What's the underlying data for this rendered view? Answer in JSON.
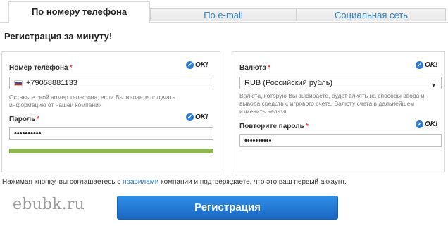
{
  "tabs": [
    {
      "label": "По номеру телефона",
      "active": true
    },
    {
      "label": "По e-mail",
      "active": false
    },
    {
      "label": "Социальная сеть",
      "active": false
    }
  ],
  "section_title": "Регистрация за минуту!",
  "left": {
    "phone": {
      "label": "Номер телефона",
      "required": "*",
      "ok": "OK!",
      "value": "+79058881133",
      "hint": "Оставьте свой номер телефона, если Вы желаете получать информацию от нашей компании"
    },
    "password": {
      "label": "Пароль",
      "required": "*",
      "ok": "OK!",
      "value": "••••••••••",
      "strength": 1.0
    }
  },
  "right": {
    "currency": {
      "label": "Валюта",
      "required": "*",
      "ok": "OK!",
      "value": "RUB (Российский рубль)",
      "hint": "Валюта, которую Вы выбираете, будет влиять на способы ввода и вывода средств с игрового счета. Валюту счета в дальнейшем изменить нельзя."
    },
    "repeat_password": {
      "label": "Повторите пароль",
      "required": "*",
      "ok": "OK!",
      "value": "••••••••••"
    }
  },
  "agreement": {
    "before": "Нажимая кнопку, вы соглашаетесь с",
    "link": "правилами",
    "after": "компании и подтверждаете, что это ваш первый аккаунт."
  },
  "watermark": "ebubk.ru",
  "register_button": "Регистрация"
}
